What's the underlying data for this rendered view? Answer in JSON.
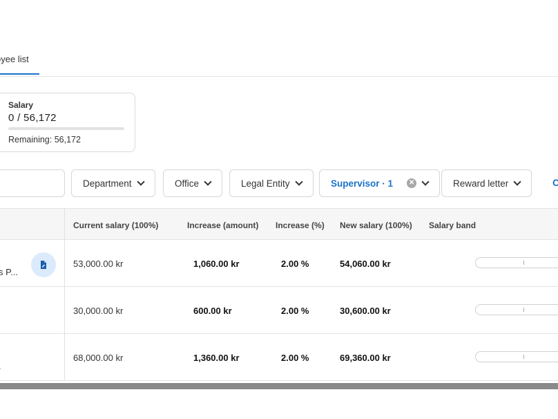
{
  "tabs": {
    "active_label": "oyee list"
  },
  "salary_card": {
    "label": "Salary",
    "value_text": "0  /  56,172",
    "used": 0,
    "total": 56172,
    "remaining_text": "Remaining: 56,172"
  },
  "filters": {
    "department": "Department",
    "office": "Office",
    "legal_entity": "Legal Entity",
    "supervisor": "Supervisor · 1",
    "reward_letter": "Reward letter",
    "more": "C"
  },
  "table": {
    "headers": {
      "current": "Current salary (100%)",
      "increase_amount": "Increase (amount)",
      "increase_pct": "Increase (%)",
      "new_salary": "New salary (100%)",
      "band": "Salary band"
    },
    "rows": [
      {
        "name": "s P...",
        "current": "53,000.00 kr",
        "increase_amount": "1,060.00 kr",
        "increase_pct": "2.00 %",
        "new_salary": "54,060.00 kr"
      },
      {
        "name": "",
        "current": "30,000.00 kr",
        "increase_amount": "600.00 kr",
        "increase_pct": "2.00 %",
        "new_salary": "30,600.00 kr"
      },
      {
        "name": ".",
        "current": "68,000.00 kr",
        "increase_amount": "1,360.00 kr",
        "increase_pct": "2.00 %",
        "new_salary": "69,360.00 kr"
      }
    ]
  },
  "colors": {
    "accent": "#1a73c9"
  }
}
